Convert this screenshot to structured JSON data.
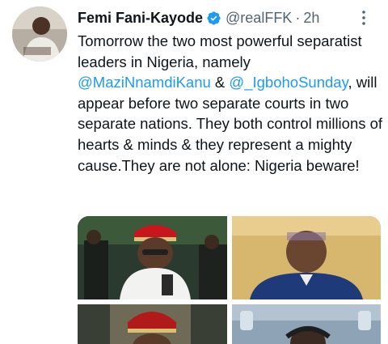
{
  "tweet": {
    "author_name": "Femi Fani-Kayode",
    "handle": "@realFFK",
    "separator": "·",
    "time": "2h",
    "text_part1": "Tomorrow the two most powerful separatist leaders in Nigeria, namely ",
    "mention1": "@MaziNnamdiKanu",
    "text_part2": " & ",
    "mention2": "@_IgbohoSunday",
    "text_part3": ", will appear before two separate courts in two separate nations. They both control millions of hearts & minds & they represent a mighty cause.They are not alone: Nigeria beware!"
  },
  "colors": {
    "accent": "#1d9bf0",
    "text": "#0f1419",
    "secondary": "#536471"
  },
  "icons": {
    "verified": "verified-badge-icon",
    "more": "more-options-icon"
  }
}
